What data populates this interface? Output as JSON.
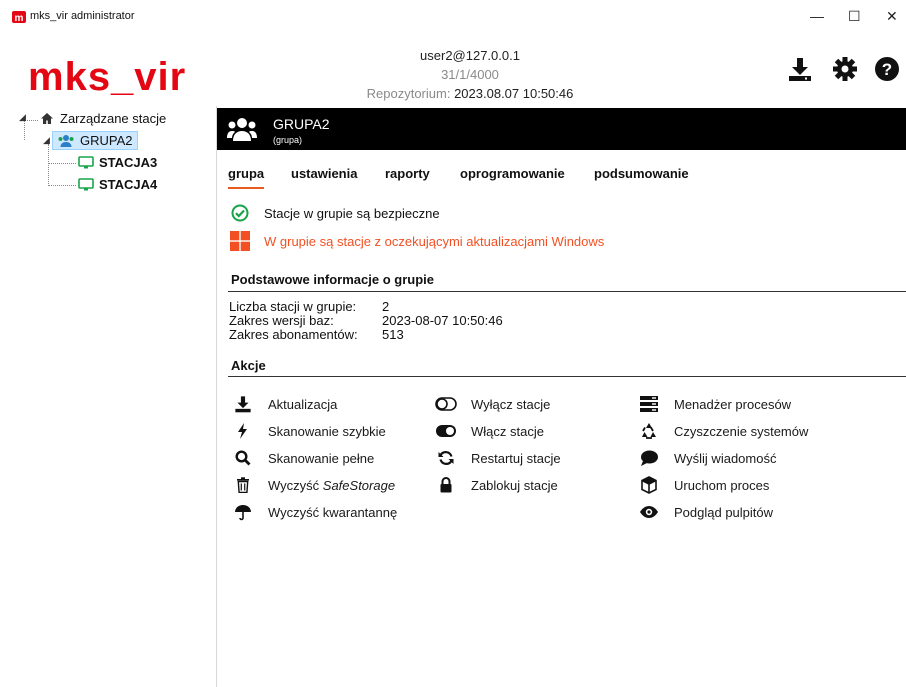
{
  "window": {
    "title": "mks_vir administrator",
    "controls": {
      "minimize": "—",
      "maximize": "☐",
      "close": "✕"
    }
  },
  "logo": {
    "text": "mks_vir"
  },
  "header": {
    "user": "user2@127.0.0.1",
    "version": "31/1/4000",
    "repo_label": "Repozytorium:",
    "repo_value": "2023.08.07 10:50:46"
  },
  "toolbar": {
    "icons": [
      "download-icon",
      "gear-icon",
      "help-icon"
    ]
  },
  "tree": {
    "root": {
      "label": "Zarządzane stacje",
      "icon": "home-icon"
    },
    "group": {
      "label": "GRUPA2",
      "icon": "users-icon"
    },
    "stations": [
      {
        "label": "STACJA3",
        "icon": "monitor-icon"
      },
      {
        "label": "STACJA4",
        "icon": "monitor-icon"
      }
    ]
  },
  "group_header": {
    "name": "GRUPA2",
    "subtitle": "(grupa)"
  },
  "tabs": [
    "grupa",
    "ustawienia",
    "raporty",
    "oprogramowanie",
    "podsumowanie"
  ],
  "active_tab": "grupa",
  "status": {
    "safe_text": "Stacje w grupie są bezpieczne",
    "windows_text": "W grupie są stacje z oczekującymi aktualizacjami Windows"
  },
  "basic_info": {
    "title": "Podstawowe informacje o grupie",
    "rows": [
      {
        "label": "Liczba stacji w grupie:",
        "value": "2"
      },
      {
        "label": "Zakres wersji baz:",
        "value": "2023-08-07 10:50:46"
      },
      {
        "label": "Zakres abonamentów:",
        "value": "513"
      }
    ]
  },
  "actions": {
    "title": "Akcje",
    "col1": [
      {
        "label": "Aktualizacja",
        "icon": "download-icon"
      },
      {
        "label": "Skanowanie szybkie",
        "icon": "lightning-icon"
      },
      {
        "label": "Skanowanie pełne",
        "icon": "search-icon"
      },
      {
        "label": "Wyczyść ",
        "label_em": "SafeStorage",
        "icon": "trash-icon"
      },
      {
        "label": "Wyczyść kwarantannę",
        "icon": "umbrella-icon"
      }
    ],
    "col2": [
      {
        "label": "Wyłącz stacje",
        "icon": "toggle-off-icon"
      },
      {
        "label": "Włącz stacje",
        "icon": "toggle-on-icon"
      },
      {
        "label": "Restartuj stacje",
        "icon": "refresh-icon"
      },
      {
        "label": "Zablokuj stacje",
        "icon": "lock-icon"
      }
    ],
    "col3": [
      {
        "label": "Menadżer procesów",
        "icon": "server-icon"
      },
      {
        "label": "Czyszczenie systemów",
        "icon": "recycle-icon"
      },
      {
        "label": "Wyślij wiadomość",
        "icon": "message-icon"
      },
      {
        "label": "Uruchom proces",
        "icon": "cube-icon"
      },
      {
        "label": "Podgląd pulpitów",
        "icon": "eye-icon"
      }
    ]
  },
  "colors": {
    "brand_red": "#e30613",
    "accent_orange": "#e85a20",
    "safe_green": "#1aa34a",
    "windows_orange": "#f25022",
    "tree_green": "#1aa34a",
    "tree_blue": "#2a7fc9"
  }
}
